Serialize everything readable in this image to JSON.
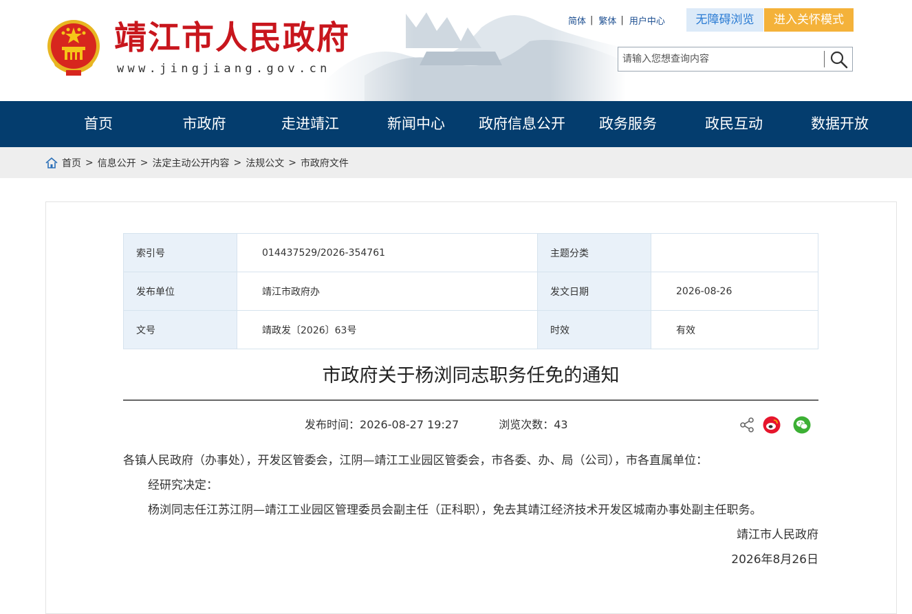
{
  "header": {
    "site_title": "靖江市人民政府",
    "site_url": "www.jingjiang.gov.cn",
    "links": [
      "简体",
      "繁体",
      "用户中心"
    ],
    "accessible_label": "无障碍浏览",
    "care_mode_label": "进入关怀模式",
    "search_placeholder": "请输入您想查询内容",
    "colors": {
      "title": "#c8161d",
      "nav": "#043d6e",
      "care": "#f4b23a",
      "access_bg": "#dceaf8"
    }
  },
  "nav": [
    "首页",
    "市政府",
    "走进靖江",
    "新闻中心",
    "政府信息公开",
    "政务服务",
    "政民互动",
    "数据开放"
  ],
  "breadcrumb": [
    "首页",
    "信息公开",
    "法定主动公开内容",
    "法规公文",
    "市政府文件"
  ],
  "meta_table": [
    {
      "k1": "索引号",
      "v1": "014437529/2026-354761",
      "k2": "主题分类",
      "v2": ""
    },
    {
      "k1": "发布单位",
      "v1": "靖江市政府办",
      "k2": "发文日期",
      "v2": "2026-08-26"
    },
    {
      "k1": "文号",
      "v1": "靖政发〔2026〕63号",
      "k2": "时效",
      "v2": "有效"
    }
  ],
  "article": {
    "title": "市政府关于杨浏同志职务任免的通知",
    "publish_time_label": "发布时间：",
    "publish_time": "2026-08-27 19:27",
    "views_label": "浏览次数：",
    "views": "43",
    "salutation": "各镇人民政府（办事处），开发区管委会，江阴—靖江工业园区管委会，市各委、办、局（公司），市各直属单位：",
    "para1": "经研究决定：",
    "para2": "杨浏同志任江苏江阴—靖江工业园区管理委员会副主任（正科职），免去其靖江经济技术开发区城南办事处副主任职务。",
    "signer": "靖江市人民政府",
    "date": "2026年8月26日"
  },
  "share_icons": [
    "share-icon",
    "weibo-icon",
    "wechat-icon"
  ]
}
